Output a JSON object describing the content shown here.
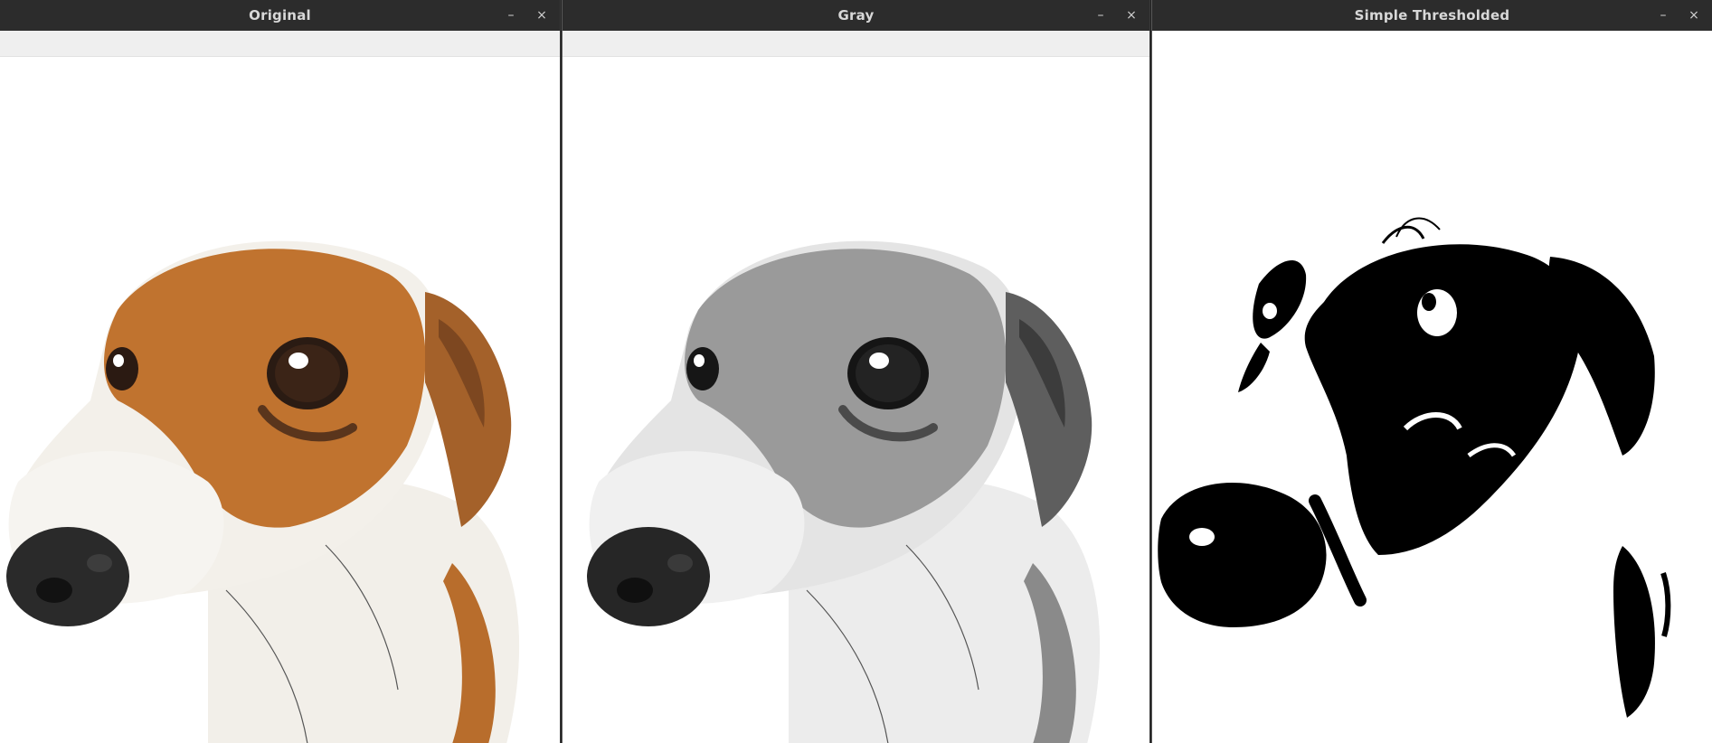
{
  "windows": [
    {
      "title": "Original",
      "minimize_label": "–",
      "close_label": "×",
      "image": "color-dog-photo"
    },
    {
      "title": "Gray",
      "minimize_label": "–",
      "close_label": "×",
      "image": "grayscale-dog-photo"
    },
    {
      "title": "Simple Thresholded",
      "minimize_label": "–",
      "close_label": "×",
      "image": "thresholded-dog-photo"
    }
  ],
  "colors": {
    "titlebar": "#2c2c2c",
    "title_text": "#d8d8d8",
    "toolbar": "#efefef",
    "fur_orange": "#c0732f",
    "fur_white": "#f4f2ee",
    "nose": "#2a2a2a"
  }
}
